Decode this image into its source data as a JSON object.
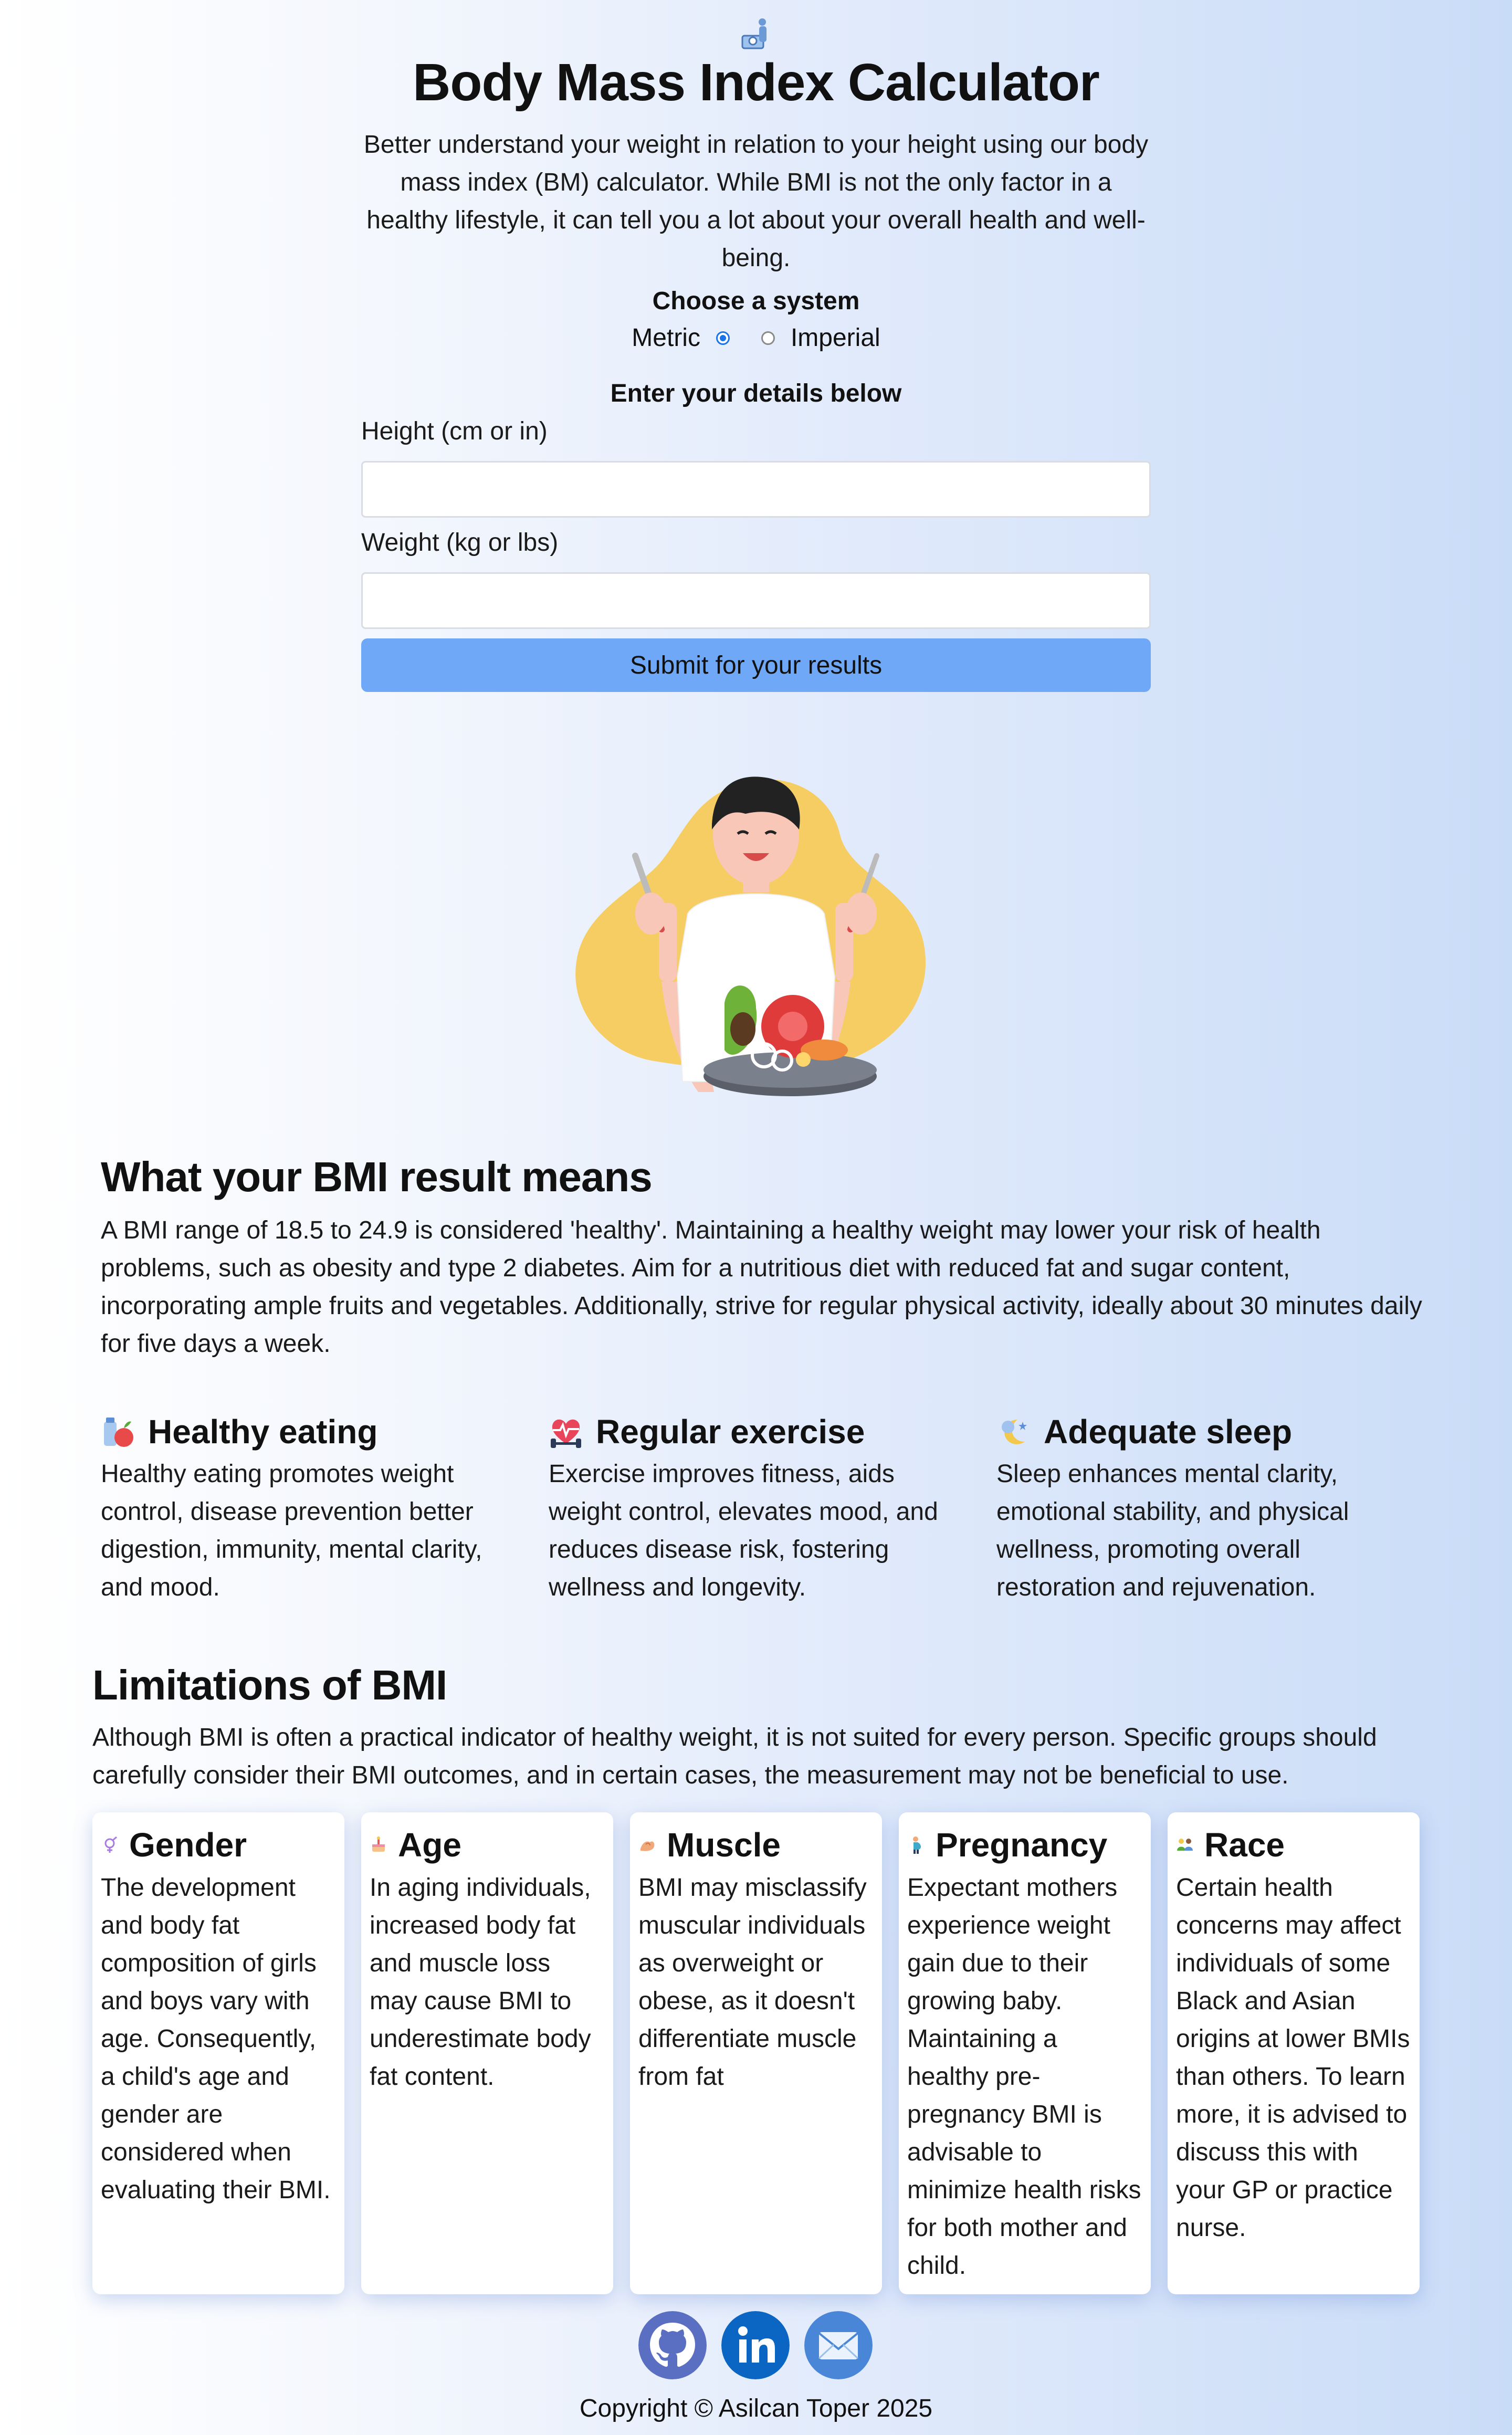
{
  "header": {
    "icon": "scale-person-icon",
    "title": "Body Mass Index Calculator",
    "intro": "Better understand your weight in relation to your height using our body mass index (BM) calculator. While BMI is not the only factor in a healthy lifestyle, it can tell you a lot about your overall health and well-being."
  },
  "form": {
    "system_label": "Choose a system",
    "systems": [
      {
        "label": "Metric",
        "checked": true
      },
      {
        "label": "Imperial",
        "checked": false
      }
    ],
    "details_label": "Enter your details below",
    "height_label": "Height (cm or in)",
    "height_value": "",
    "weight_label": "Weight (kg or lbs)",
    "weight_value": "",
    "submit_label": "Submit for your results"
  },
  "illustration": "person-eating-salad-illustration",
  "result_section": {
    "title": "What your BMI result means",
    "body": "A BMI range of 18.5 to 24.9 is considered 'healthy'. Maintaining a healthy weight may lower your risk of health problems, such as obesity and type 2 diabetes. Aim for a nutritious diet with reduced fat and sugar content, incorporating ample fruits and vegetables. Additionally, strive for regular physical activity, ideally about 30 minutes daily for five days a week."
  },
  "tips": [
    {
      "icon": "healthy-food-icon",
      "title": "Healthy eating",
      "text": "Healthy eating promotes weight control, disease prevention better digestion, immunity, mental clarity, and mood."
    },
    {
      "icon": "heartbeat-dumbbell-icon",
      "title": "Regular exercise",
      "text": "Exercise improves fitness, aids weight control, elevates mood, and reduces disease risk, fostering wellness and longevity."
    },
    {
      "icon": "moon-stars-icon",
      "title": "Adequate sleep",
      "text": "Sleep enhances mental clarity, emotional stability, and physical wellness, promoting overall restoration and rejuvenation."
    }
  ],
  "limitations": {
    "title": "Limitations of BMI",
    "body": "Although BMI is often a practical indicator of healthy weight, it is not suited for every person. Specific groups should carefully consider their BMI outcomes, and in certain cases, the measurement may not be beneficial to use.",
    "cards": [
      {
        "icon": "gender-icon",
        "title": "Gender",
        "text": "The development and body fat composition of girls and boys vary with age. Consequently, a child's age and gender are considered when evaluating their BMI."
      },
      {
        "icon": "cake-icon",
        "title": "Age",
        "text": "In aging individuals, increased body fat and muscle loss may cause BMI to underestimate body fat content."
      },
      {
        "icon": "flexed-bicep-icon",
        "title": "Muscle",
        "text": "BMI may misclassify muscular individuals as overweight or obese, as it doesn't differentiate muscle from fat"
      },
      {
        "icon": "pregnant-woman-icon",
        "title": "Pregnancy",
        "text": "Expectant mothers experience weight gain due to their growing baby. Maintaining a healthy pre-pregnancy BMI is advisable to minimize health risks for both mother and child."
      },
      {
        "icon": "people-group-icon",
        "title": "Race",
        "text": "Certain health concerns may affect individuals of some Black and Asian origins at lower BMIs than others. To learn more, it is advised to discuss this with your GP or practice nurse."
      }
    ]
  },
  "footer": {
    "social": [
      {
        "icon": "github-icon",
        "color": "#5b6fc2"
      },
      {
        "icon": "linkedin-icon",
        "color": "#0a66c2"
      },
      {
        "icon": "email-icon",
        "color": "#4a86d8"
      }
    ],
    "copyright": "Copyright © Asilcan Toper 2025"
  }
}
